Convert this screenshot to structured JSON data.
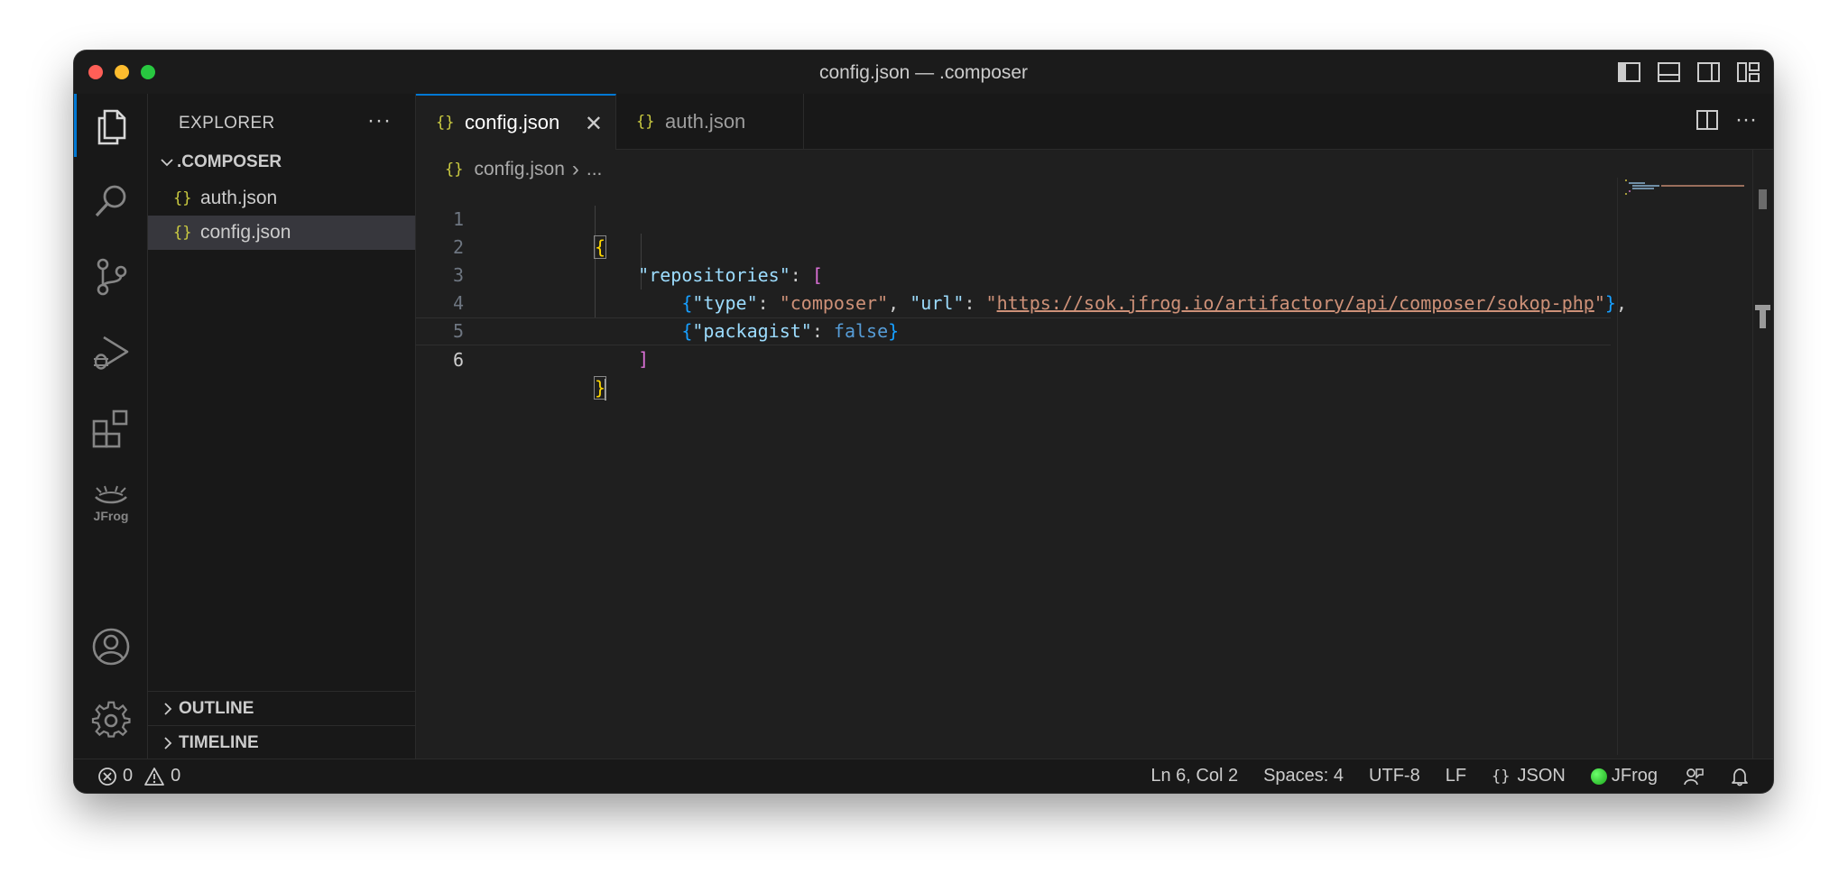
{
  "window": {
    "title": "config.json — .composer"
  },
  "colors": {
    "accent": "#0078d4",
    "json_icon": "#cbcb41",
    "background": "#1f1f1f",
    "jfrog_status": "#2ecc40"
  },
  "activity_bar": {
    "items": [
      {
        "icon": "files-icon",
        "active": true
      },
      {
        "icon": "search-icon"
      },
      {
        "icon": "source-control-icon"
      },
      {
        "icon": "run-debug-icon"
      },
      {
        "icon": "extensions-icon"
      },
      {
        "icon": "jfrog-icon",
        "label": "JFrog"
      }
    ],
    "bottom": [
      {
        "icon": "account-icon"
      },
      {
        "icon": "gear-icon"
      }
    ]
  },
  "sidebar": {
    "title": "EXPLORER",
    "more": "···",
    "folder": ".COMPOSER",
    "files": [
      {
        "icon": "{}",
        "name": "auth.json",
        "selected": false
      },
      {
        "icon": "{}",
        "name": "config.json",
        "selected": true
      }
    ],
    "sections": [
      {
        "label": "OUTLINE"
      },
      {
        "label": "TIMELINE"
      }
    ]
  },
  "tabs": [
    {
      "icon": "{}",
      "label": "config.json",
      "active": true,
      "close": "✕"
    },
    {
      "icon": "{}",
      "label": "auth.json",
      "active": false
    }
  ],
  "editor_actions": {
    "more": "···"
  },
  "breadcrumb": {
    "icon": "{}",
    "file": "config.json",
    "sep": "›",
    "rest": "..."
  },
  "code": {
    "line_numbers": [
      "1",
      "2",
      "3",
      "4",
      "5",
      "6"
    ],
    "l1_open": "{",
    "l2_key": "\"repositories\"",
    "l2_colon": ": ",
    "l2_bracket": "[",
    "l3_open": "{",
    "l3_key1": "\"type\"",
    "l3_colon1": ": ",
    "l3_val1": "\"composer\"",
    "l3_comma1": ", ",
    "l3_key2": "\"url\"",
    "l3_colon2": ": ",
    "l3_quote_open": "\"",
    "l3_url": "https://sok.jfrog.io/artifactory/api/composer/sokop-php",
    "l3_quote_close": "\"",
    "l3_close": "}",
    "l3_comma2": ",",
    "l4_open": "{",
    "l4_key": "\"packagist\"",
    "l4_colon": ": ",
    "l4_val": "false",
    "l4_close": "}",
    "l5_close": "]",
    "l6_close": "}"
  },
  "statusbar": {
    "errors": "0",
    "warnings": "0",
    "position": "Ln 6, Col 2",
    "spaces": "Spaces: 4",
    "encoding": "UTF-8",
    "eol": "LF",
    "language_icon": "{}",
    "language": "JSON",
    "jfrog": "JFrog"
  }
}
